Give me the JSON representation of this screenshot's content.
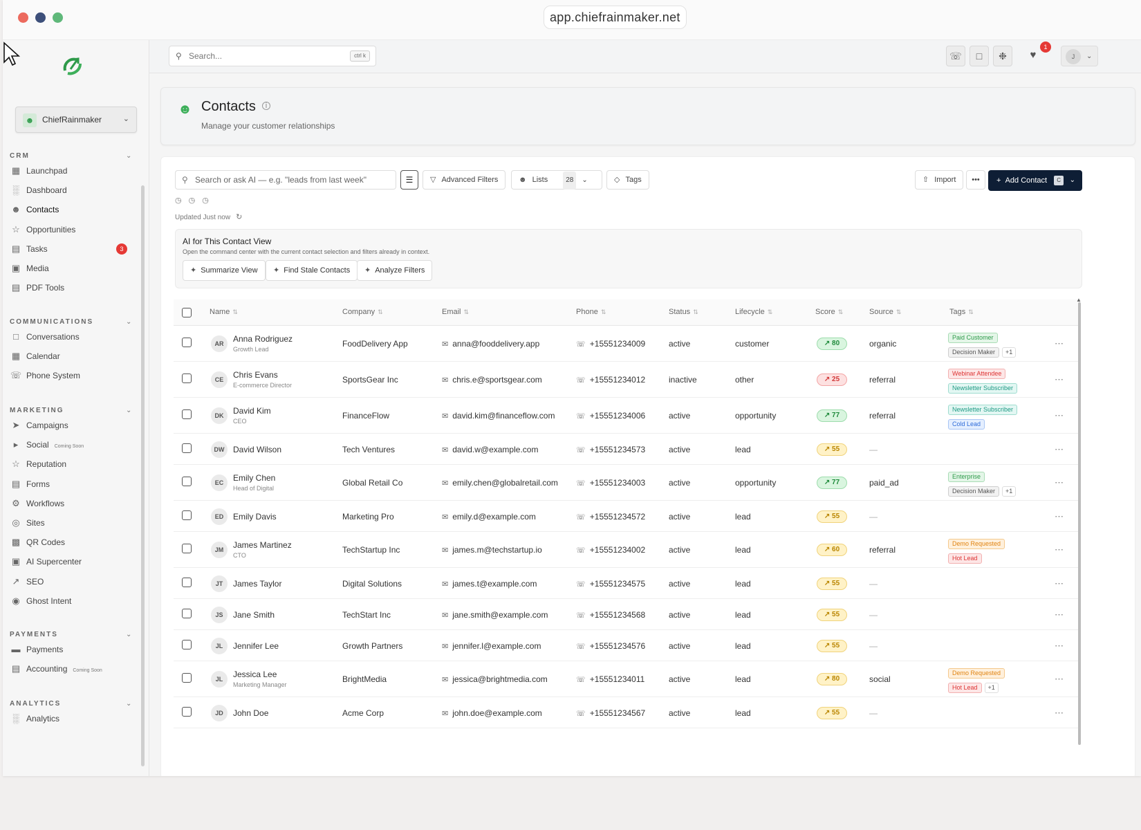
{
  "browser": {
    "url": "app.chiefrainmaker.net"
  },
  "sidebar": {
    "org_name": "ChiefRainmaker",
    "groups": [
      {
        "label": "CRM",
        "items": [
          {
            "label": "Launchpad",
            "icon": "grid-icon"
          },
          {
            "label": "Dashboard",
            "icon": "bar-chart-icon"
          },
          {
            "label": "Contacts",
            "icon": "users-icon",
            "active": true
          },
          {
            "label": "Opportunities",
            "icon": "star-icon"
          },
          {
            "label": "Tasks",
            "icon": "file-icon",
            "badge": "3"
          },
          {
            "label": "Media",
            "icon": "image-icon"
          },
          {
            "label": "PDF Tools",
            "icon": "document-icon"
          }
        ]
      },
      {
        "label": "COMMUNICATIONS",
        "items": [
          {
            "label": "Conversations",
            "icon": "chat-icon"
          },
          {
            "label": "Calendar",
            "icon": "calendar-icon"
          },
          {
            "label": "Phone System",
            "icon": "phone-icon"
          }
        ]
      },
      {
        "label": "MARKETING",
        "items": [
          {
            "label": "Campaigns",
            "icon": "send-icon"
          },
          {
            "label": "Social",
            "icon": "megaphone-icon",
            "soon": "Coming Soon"
          },
          {
            "label": "Reputation",
            "icon": "star-icon"
          },
          {
            "label": "Forms",
            "icon": "form-icon"
          },
          {
            "label": "Workflows",
            "icon": "workflow-icon"
          },
          {
            "label": "Sites",
            "icon": "globe-icon"
          },
          {
            "label": "QR Codes",
            "icon": "qr-icon"
          },
          {
            "label": "AI Supercenter",
            "icon": "robot-icon"
          },
          {
            "label": "SEO",
            "icon": "trend-icon"
          },
          {
            "label": "Ghost Intent",
            "icon": "eye-icon"
          }
        ]
      },
      {
        "label": "PAYMENTS",
        "items": [
          {
            "label": "Payments",
            "icon": "card-icon"
          },
          {
            "label": "Accounting",
            "icon": "book-icon",
            "soon": "Coming Soon"
          }
        ]
      },
      {
        "label": "ANALYTICS",
        "items": [
          {
            "label": "Analytics",
            "icon": "bar-chart-icon"
          }
        ]
      }
    ]
  },
  "topbar": {
    "search_placeholder": "Search...",
    "shortcut": "ctrl k",
    "notification_count": "1",
    "user_initial": "J"
  },
  "header": {
    "title": "Contacts",
    "subtitle": "Manage your customer relationships"
  },
  "toolbar": {
    "search_placeholder": "Search or ask AI — e.g. \"leads from last week\"",
    "advanced_filters": "Advanced Filters",
    "lists": "Lists",
    "lists_count": "28",
    "tags": "Tags",
    "import": "Import",
    "more": "•••",
    "add_contact": "Add Contact",
    "add_shortcut": "C",
    "updated": "Updated Just now"
  },
  "ai_panel": {
    "title": "AI for This Contact View",
    "subtitle": "Open the command center with the current contact selection and filters already in context.",
    "buttons": [
      "Summarize View",
      "Find Stale Contacts",
      "Analyze Filters"
    ]
  },
  "table": {
    "columns": [
      "Name",
      "Company",
      "Email",
      "Phone",
      "Status",
      "Lifecycle",
      "Score",
      "Source",
      "Tags"
    ],
    "rows": [
      {
        "initials": "AR",
        "name": "Anna Rodriguez",
        "title": "Growth Lead",
        "company": "FoodDelivery App",
        "email": "anna@fooddelivery.app",
        "phone": "+15551234009",
        "status": "active",
        "lifecycle": "customer",
        "score": "80",
        "score_color": "green",
        "source": "organic",
        "tags": [
          {
            "label": "Paid Customer",
            "style": "green"
          },
          {
            "label": "Decision Maker",
            "style": "gray"
          }
        ],
        "extra": "+1"
      },
      {
        "initials": "CE",
        "name": "Chris Evans",
        "title": "E-commerce Director",
        "company": "SportsGear Inc",
        "email": "chris.e@sportsgear.com",
        "phone": "+15551234012",
        "status": "inactive",
        "lifecycle": "other",
        "score": "25",
        "score_color": "red",
        "source": "referral",
        "tags": [
          {
            "label": "Webinar Attendee",
            "style": "red"
          },
          {
            "label": "Newsletter Subscriber",
            "style": "teal"
          }
        ],
        "extra": ""
      },
      {
        "initials": "DK",
        "name": "David Kim",
        "title": "CEO",
        "company": "FinanceFlow",
        "email": "david.kim@financeflow.com",
        "phone": "+15551234006",
        "status": "active",
        "lifecycle": "opportunity",
        "score": "77",
        "score_color": "green",
        "source": "referral",
        "tags": [
          {
            "label": "Newsletter Subscriber",
            "style": "teal"
          },
          {
            "label": "Cold Lead",
            "style": "blue"
          }
        ],
        "extra": ""
      },
      {
        "initials": "DW",
        "name": "David Wilson",
        "title": "",
        "company": "Tech Ventures",
        "email": "david.w@example.com",
        "phone": "+15551234573",
        "status": "active",
        "lifecycle": "lead",
        "score": "55",
        "score_color": "yellow",
        "source": "—",
        "tags": [],
        "extra": ""
      },
      {
        "initials": "EC",
        "name": "Emily Chen",
        "title": "Head of Digital",
        "company": "Global Retail Co",
        "email": "emily.chen@globalretail.com",
        "phone": "+15551234003",
        "status": "active",
        "lifecycle": "opportunity",
        "score": "77",
        "score_color": "green",
        "source": "paid_ad",
        "tags": [
          {
            "label": "Enterprise",
            "style": "green"
          },
          {
            "label": "Decision Maker",
            "style": "gray"
          }
        ],
        "extra": "+1"
      },
      {
        "initials": "ED",
        "name": "Emily Davis",
        "title": "",
        "company": "Marketing Pro",
        "email": "emily.d@example.com",
        "phone": "+15551234572",
        "status": "active",
        "lifecycle": "lead",
        "score": "55",
        "score_color": "yellow",
        "source": "—",
        "tags": [],
        "extra": ""
      },
      {
        "initials": "JM",
        "name": "James Martinez",
        "title": "CTO",
        "company": "TechStartup Inc",
        "email": "james.m@techstartup.io",
        "phone": "+15551234002",
        "status": "active",
        "lifecycle": "lead",
        "score": "60",
        "score_color": "yellow",
        "source": "referral",
        "tags": [
          {
            "label": "Demo Requested",
            "style": "orange"
          },
          {
            "label": "Hot Lead",
            "style": "red"
          }
        ],
        "extra": ""
      },
      {
        "initials": "JT",
        "name": "James Taylor",
        "title": "",
        "company": "Digital Solutions",
        "email": "james.t@example.com",
        "phone": "+15551234575",
        "status": "active",
        "lifecycle": "lead",
        "score": "55",
        "score_color": "yellow",
        "source": "—",
        "tags": [],
        "extra": ""
      },
      {
        "initials": "JS",
        "name": "Jane Smith",
        "title": "",
        "company": "TechStart Inc",
        "email": "jane.smith@example.com",
        "phone": "+15551234568",
        "status": "active",
        "lifecycle": "lead",
        "score": "55",
        "score_color": "yellow",
        "source": "—",
        "tags": [],
        "extra": ""
      },
      {
        "initials": "JL",
        "name": "Jennifer Lee",
        "title": "",
        "company": "Growth Partners",
        "email": "jennifer.l@example.com",
        "phone": "+15551234576",
        "status": "active",
        "lifecycle": "lead",
        "score": "55",
        "score_color": "yellow",
        "source": "—",
        "tags": [],
        "extra": ""
      },
      {
        "initials": "JL",
        "name": "Jessica Lee",
        "title": "Marketing Manager",
        "company": "BrightMedia",
        "email": "jessica@brightmedia.com",
        "phone": "+15551234011",
        "status": "active",
        "lifecycle": "lead",
        "score": "80",
        "score_color": "yellow",
        "source": "social",
        "tags": [
          {
            "label": "Demo Requested",
            "style": "orange"
          },
          {
            "label": "Hot Lead",
            "style": "red"
          }
        ],
        "extra": "+1"
      },
      {
        "initials": "JD",
        "name": "John Doe",
        "title": "",
        "company": "Acme Corp",
        "email": "john.doe@example.com",
        "phone": "+15551234567",
        "status": "active",
        "lifecycle": "lead",
        "score": "55",
        "score_color": "yellow",
        "source": "—",
        "tags": [],
        "extra": ""
      }
    ]
  },
  "colors": {
    "primary": "#0e1e35",
    "accent_green": "#3daf5a",
    "badge_red": "#e53935"
  }
}
